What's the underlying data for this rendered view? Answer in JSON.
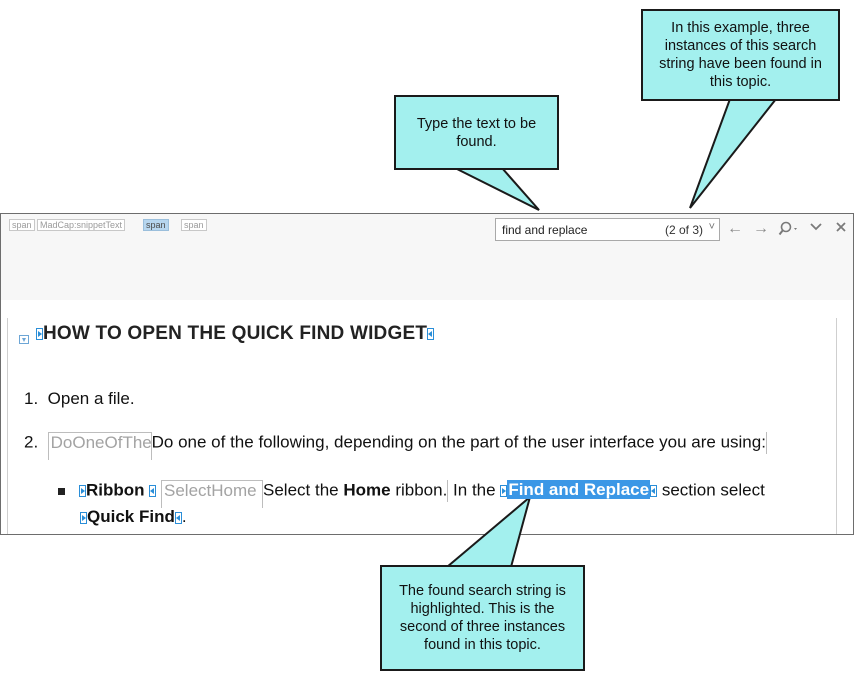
{
  "callouts": {
    "type_text": "Type the text to be found.",
    "instances": "In this example, three instances of this search string have been found in this topic.",
    "highlighted": "The found search string is highlighted. This is the second of three instances found in this topic."
  },
  "breadcrumb_tags": [
    "span",
    "MadCap:snippetText",
    "span",
    "span"
  ],
  "find": {
    "value": "find and replace",
    "count": "(2 of 3)",
    "dropdown_glyph": "˅"
  },
  "toolbar_icons": [
    "arrow-left-icon",
    "arrow-right-icon",
    "search-options-icon",
    "chevron-down-icon",
    "close-icon"
  ],
  "document": {
    "heading": "HOW TO OPEN THE QUICK FIND WIDGET",
    "step1_num": "1.",
    "step1_text": "Open a file.",
    "step2_num": "2.",
    "step2_snippet": "DoOneOfThe",
    "step2_text": "Do one of the following, depending on the part of the user interface you are using:",
    "bullet_label": "Ribbon",
    "bullet_snippet": "SelectHome",
    "bullet_select": "Select the",
    "bullet_home": "Home",
    "bullet_ribbon": "ribbon.",
    "bullet_in_the": "In the",
    "bullet_highlight": "Find and Replace",
    "bullet_section": "section select",
    "bullet_quick_find": "Quick Find",
    "bullet_period": "."
  },
  "colors": {
    "callout_fill": "#a3f0ee",
    "highlight": "#3b97e6",
    "marker": "#2a8ed8"
  }
}
